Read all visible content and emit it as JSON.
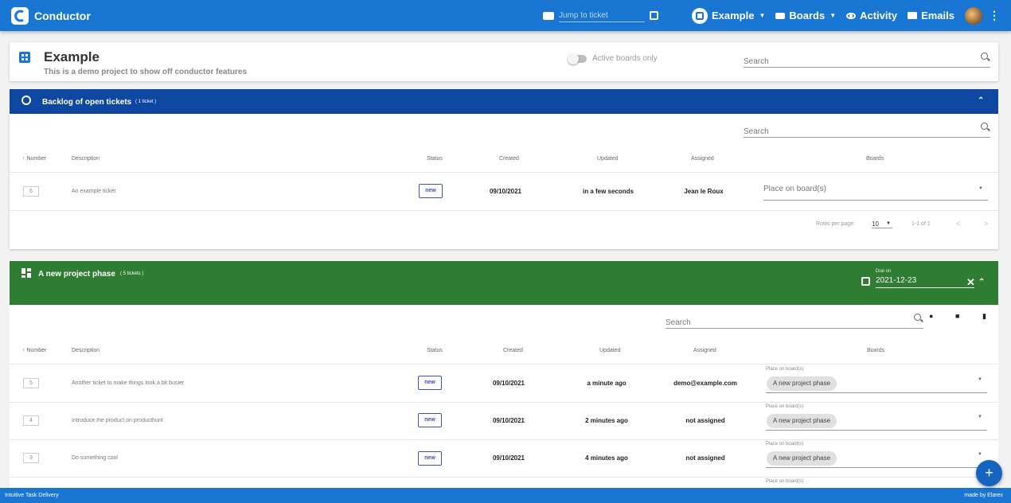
{
  "app": {
    "brand": "Conductor",
    "jump_placeholder": "Jump to ticket",
    "project_menu": "Example",
    "boards_menu": "Boards",
    "activity": "Activity",
    "emails": "Emails"
  },
  "project": {
    "title": "Example",
    "description": "This is a demo project to show off conductor features",
    "active_boards_label": "Active boards only",
    "search_placeholder": "Search"
  },
  "backlog": {
    "title": "Backlog of open tickets",
    "count": "( 1 ticket )",
    "search_placeholder": "Search",
    "headers": {
      "number": "↑ Number",
      "description": "Description",
      "status": "Status",
      "created": "Created",
      "updated": "Updated",
      "assigned": "Assigned",
      "boards": "Boards"
    },
    "rows": [
      {
        "number": "6",
        "description": "An example ticket",
        "status": "new",
        "created": "09/10/2021",
        "updated": "in a few seconds",
        "assigned": "Jean le Roux",
        "boards_placeholder": "Place on board(s)"
      }
    ],
    "pagination": {
      "rows_per_page_label": "Rows per page:",
      "rows_per_page": "10",
      "range": "1-1 of 1"
    }
  },
  "phase": {
    "title": "A new project phase",
    "count": "( 5 tickets )",
    "due_label": "Due on",
    "due_value": "2021-12-23",
    "search_placeholder": "Search",
    "headers": {
      "number": "↑ Number",
      "description": "Description",
      "status": "Status",
      "created": "Created",
      "updated": "Updated",
      "assigned": "Assigned",
      "boards": "Boards"
    },
    "board_field_label": "Place on board(s)",
    "rows": [
      {
        "number": "5",
        "description": "Another ticket to make things look a bit busier",
        "status": "new",
        "created": "09/10/2021",
        "updated": "a minute ago",
        "assigned": "demo@example.com",
        "board_chip": "A new project phase"
      },
      {
        "number": "4",
        "description": "Introduce the product on producthunt",
        "status": "new",
        "created": "09/10/2021",
        "updated": "2 minutes ago",
        "assigned": "not assigned",
        "board_chip": "A new project phase"
      },
      {
        "number": "3",
        "description": "Do something cool",
        "status": "new",
        "created": "09/10/2021",
        "updated": "4 minutes ago",
        "assigned": "not assigned",
        "board_chip": "A new project phase"
      }
    ]
  },
  "footer": {
    "left": "Intuitive Task Delivery",
    "right": "made by Elarex"
  },
  "colors": {
    "appbar": "#1976d2",
    "backlog_banner": "#0d47a1",
    "phase_banner": "#2e7d32",
    "status_new": "#3f51b5"
  }
}
